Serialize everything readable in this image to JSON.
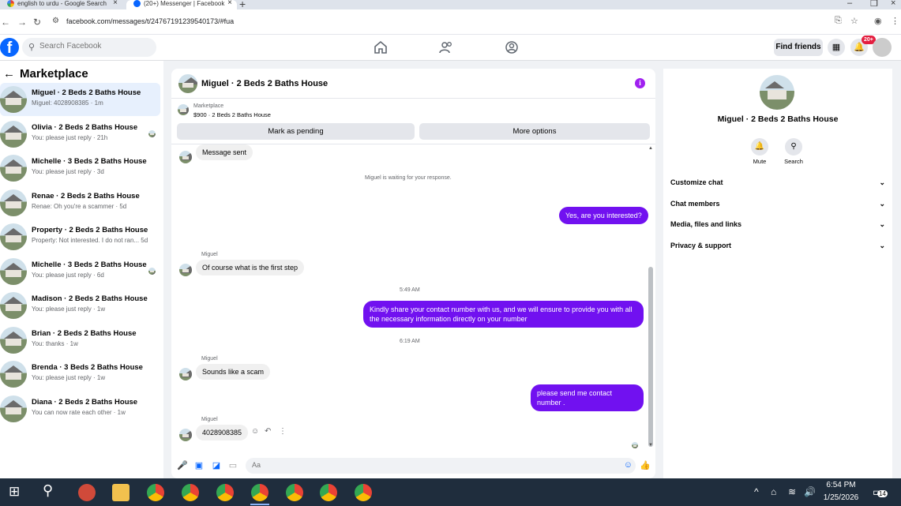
{
  "browser": {
    "tabs": [
      {
        "title": "english to urdu - Google Search"
      },
      {
        "title": "(20+) Messenger | Facebook"
      }
    ],
    "url": "facebook.com/messages/t/24767191239540173/#fua"
  },
  "fb": {
    "search_placeholder": "Search Facebook",
    "find_friends": "Find friends",
    "notif_count": "20+"
  },
  "sidebar": {
    "title": "Marketplace",
    "conversations": [
      {
        "name": "Miguel · 2 Beds 2 Baths House",
        "preview": "Miguel: 4028908385 · 1m",
        "active": true
      },
      {
        "name": "Olivia · 2 Beds 2 Baths House",
        "preview": "You: please just reply · 21h"
      },
      {
        "name": "Michelle · 3 Beds 2 Baths House",
        "preview": "You: please just reply · 3d"
      },
      {
        "name": "Renae · 2 Beds 2 Baths House",
        "preview": "Renae: Oh you're a scammer · 5d"
      },
      {
        "name": "Property · 2 Beds 2 Baths House",
        "preview": "Property: Not interested. I do not ran... 5d"
      },
      {
        "name": "Michelle · 3 Beds 2 Baths House",
        "preview": "You: please just reply · 6d"
      },
      {
        "name": "Madison · 2 Beds 2 Baths House",
        "preview": "You: please just reply · 1w"
      },
      {
        "name": "Brian · 2 Beds 2 Baths House",
        "preview": "You: thanks · 1w"
      },
      {
        "name": "Brenda · 3 Beds 2 Baths House",
        "preview": "You: please just reply · 1w"
      },
      {
        "name": "Diana · 2 Beds 2 Baths House",
        "preview": "You can now rate each other · 1w"
      }
    ]
  },
  "chat": {
    "title": "Miguel · 2 Beds 2 Baths House",
    "marketplace_label": "Marketplace",
    "listing": "$900 · 2 Beds 2 Baths House",
    "mark_pending": "Mark as pending",
    "more_options": "More options",
    "messages": {
      "m1": "Message sent",
      "waiting": "Miguel is waiting for your response.",
      "m2": "Yes, are you interested?",
      "sender": "Miguel",
      "m3": "Of course what is the first step",
      "t1": "5:49 AM",
      "m4": "Kindly share your contact number with us, and we will ensure to provide you with all the necessary information directly on your number",
      "t2": "6:19 AM",
      "m5": "Sounds like a scam",
      "m6": "please send me contact number .",
      "m7": "4028908385"
    },
    "composer_placeholder": "Aa"
  },
  "details": {
    "name": "Miguel · 2 Beds 2 Baths House",
    "mute": "Mute",
    "search": "Search",
    "rows": [
      "Customize chat",
      "Chat members",
      "Media, files and links",
      "Privacy & support"
    ]
  },
  "taskbar": {
    "time": "6:54 PM",
    "date": "1/25/2026",
    "notif_count": "14"
  },
  "colors": {
    "accent": "#0866ff",
    "outgoing_bubble": "#7111f0",
    "active_conv": "#e7f0fd"
  }
}
